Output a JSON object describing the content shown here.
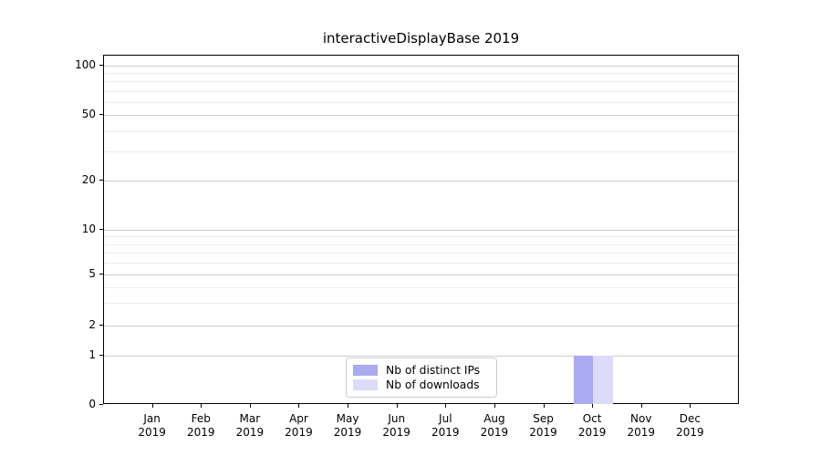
{
  "title": "interactiveDisplayBase 2019",
  "chart_data": {
    "type": "bar",
    "title": "interactiveDisplayBase 2019",
    "categories": [
      "Jan 2019",
      "Feb 2019",
      "Mar 2019",
      "Apr 2019",
      "May 2019",
      "Jun 2019",
      "Jul 2019",
      "Aug 2019",
      "Sep 2019",
      "Oct 2019",
      "Nov 2019",
      "Dec 2019"
    ],
    "series": [
      {
        "name": "Nb of distinct IPs",
        "color": "#aaaaf0",
        "values": [
          0,
          0,
          0,
          0,
          0,
          0,
          0,
          0,
          0,
          1,
          0,
          0
        ]
      },
      {
        "name": "Nb of downloads",
        "color": "#dcdcf8",
        "values": [
          0,
          0,
          0,
          0,
          0,
          0,
          0,
          0,
          0,
          1,
          0,
          0
        ]
      }
    ],
    "yscale": "symlog",
    "ylim": [
      0,
      120
    ],
    "yticks": [
      0,
      1,
      2,
      5,
      10,
      20,
      50,
      100
    ],
    "ytick_labels": [
      "0",
      "1",
      "2",
      "5",
      "10",
      "20",
      "50",
      "100"
    ],
    "minor_yticks": [
      3,
      4,
      6,
      7,
      8,
      9,
      30,
      40,
      60,
      70,
      80,
      90
    ],
    "grid": true,
    "legend_position": "bottom-center",
    "xlabel": "",
    "ylabel": ""
  },
  "colors": {
    "distinct_ips": "#aaaaf0",
    "downloads": "#dcdcf8",
    "grid_major": "#cccccc",
    "grid_minor": "#ededed",
    "spine": "#000000",
    "background": "#ffffff"
  }
}
